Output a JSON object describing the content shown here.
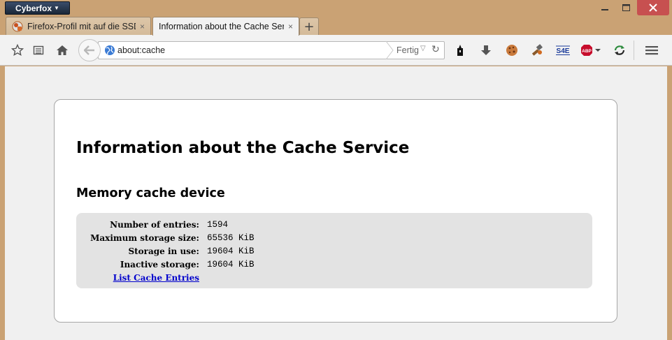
{
  "window": {
    "app_menu_label": "Cyberfox",
    "minimize_symbol": "—",
    "maximize_symbol": "☐",
    "close_symbol": "✕"
  },
  "tabs": [
    {
      "title": "Firefox-Profil mit auf die SSD ...",
      "close": "×",
      "active": false,
      "icon": "cyberfox-favicon-icon"
    },
    {
      "title": "Information about the Cache Ser...",
      "close": "×",
      "active": true
    }
  ],
  "new_tab_label": "+",
  "toolbar": {
    "url": "about:cache",
    "status": "Fertig",
    "icons": [
      "bookmark-star-icon",
      "reading-list-icon",
      "home-icon",
      "back-arrow-icon",
      "globe-icon",
      "dropdown-icon",
      "reload-icon",
      "torch-icon",
      "download-icon",
      "cookie-icon",
      "hammer-icon",
      "s4e-icon",
      "adblock-plus-icon",
      "sync-icon",
      "hamburger-menu-icon"
    ],
    "s4e_label": "S4E",
    "abp_label": "ABP"
  },
  "page": {
    "title": "Information about the Cache Service",
    "section_title": "Memory cache device",
    "rows": [
      {
        "label": "Number of entries:",
        "value": "1594"
      },
      {
        "label": "Maximum storage size:",
        "value": "65536 KiB"
      },
      {
        "label": "Storage in use:",
        "value": "19604 KiB"
      },
      {
        "label": "Inactive storage:",
        "value": "19604 KiB"
      }
    ],
    "link_label": "List Cache Entries"
  },
  "colors": {
    "frame": "#caa274",
    "link": "#0000cc",
    "info_box": "#e3e3e3",
    "close_button": "#c75050"
  }
}
